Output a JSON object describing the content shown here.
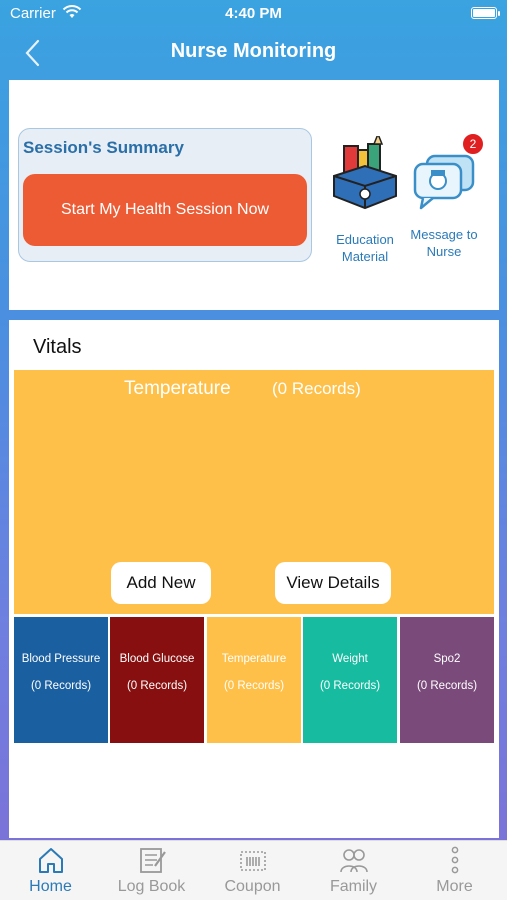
{
  "status_bar": {
    "carrier": "Carrier",
    "time": "4:40 PM"
  },
  "nav": {
    "title": "Nurse Monitoring"
  },
  "summary": {
    "title": "Session's Summary",
    "start_button": "Start My Health Session Now"
  },
  "quick_links": [
    {
      "label": "Education Material",
      "icon": "education-books-icon"
    },
    {
      "label": "Message to Nurse",
      "icon": "nurse-chat-icon",
      "badge": "2"
    }
  ],
  "vitals": {
    "title": "Vitals",
    "selected": {
      "name": "Temperature",
      "count": "(0 Records)",
      "color": "#fec048"
    },
    "add_new": "Add New",
    "view_details": "View Details",
    "tiles": [
      {
        "name": "Blood Pressure",
        "count": "(0 Records)",
        "color": "#1a5fa0"
      },
      {
        "name": "Blood Glucose",
        "count": "(0 Records)",
        "color": "#870f0f"
      },
      {
        "name": "Temperature",
        "count": "(0 Records)",
        "color": "#fec048"
      },
      {
        "name": "Weight",
        "count": "(0 Records)",
        "color": "#16bba0"
      },
      {
        "name": "Spo2",
        "count": "(0 Records)",
        "color": "#7a4b7a"
      }
    ]
  },
  "tabs": [
    {
      "label": "Home",
      "icon": "home-icon",
      "active": true
    },
    {
      "label": "Log Book",
      "icon": "log-book-icon"
    },
    {
      "label": "Coupon",
      "icon": "coupon-icon"
    },
    {
      "label": "Family",
      "icon": "family-icon"
    },
    {
      "label": "More",
      "icon": "more-dots-icon"
    }
  ],
  "colors": {
    "accent": "#2a7ab8",
    "start_button": "#ec5b33"
  }
}
